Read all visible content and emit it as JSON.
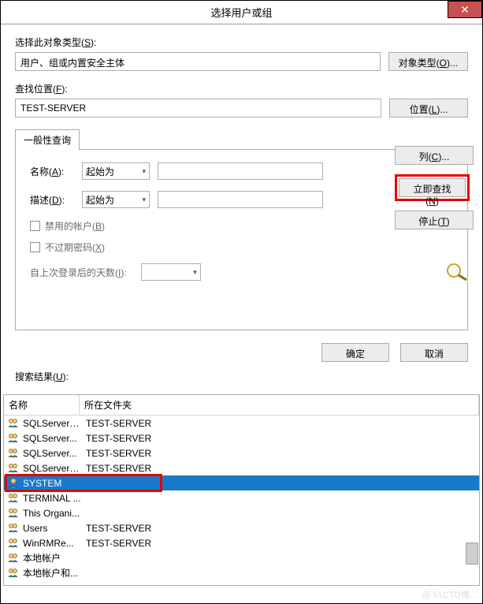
{
  "titlebar": {
    "title": "选择用户或组"
  },
  "object_type": {
    "label": "选择此对象类型(S):",
    "value": "用户、组或内置安全主体",
    "button": "对象类型(O)..."
  },
  "location": {
    "label": "查找位置(F):",
    "value": "TEST-SERVER",
    "button": "位置(L)..."
  },
  "tab": {
    "label": "一般性查询"
  },
  "query": {
    "name_label": "名称(A):",
    "name_combo": "起始为",
    "desc_label": "描述(D):",
    "desc_combo": "起始为",
    "disabled_chk": "禁用的帐户(B)",
    "noexpire_chk": "不过期密码(X)",
    "days_label": "自上次登录后的天数(I):"
  },
  "right_buttons": {
    "columns": "列(C)...",
    "find_now": "立即查找(N)",
    "stop": "停止(T)"
  },
  "bottom_buttons": {
    "ok": "确定",
    "cancel": "取消"
  },
  "results": {
    "label": "搜索结果(U):",
    "col_name": "名称",
    "col_folder": "所在文件夹",
    "rows": [
      {
        "icon": "group",
        "name": "SQLServer2...",
        "folder": "TEST-SERVER",
        "selected": false
      },
      {
        "icon": "group",
        "name": "SQLServer...",
        "folder": "TEST-SERVER",
        "selected": false
      },
      {
        "icon": "group",
        "name": "SQLServer...",
        "folder": "TEST-SERVER",
        "selected": false
      },
      {
        "icon": "group",
        "name": "SQLServerS...",
        "folder": "TEST-SERVER",
        "selected": false
      },
      {
        "icon": "user",
        "name": "SYSTEM",
        "folder": "",
        "selected": true
      },
      {
        "icon": "group",
        "name": "TERMINAL ...",
        "folder": "",
        "selected": false
      },
      {
        "icon": "group",
        "name": "This Organi...",
        "folder": "",
        "selected": false
      },
      {
        "icon": "group",
        "name": "Users",
        "folder": "TEST-SERVER",
        "selected": false
      },
      {
        "icon": "group",
        "name": "WinRMRe...",
        "folder": "TEST-SERVER",
        "selected": false
      },
      {
        "icon": "group",
        "name": "本地帐户",
        "folder": "",
        "selected": false
      },
      {
        "icon": "group",
        "name": "本地帐户和...",
        "folder": "",
        "selected": false
      }
    ]
  },
  "watermark": "@ 51CTO博..."
}
